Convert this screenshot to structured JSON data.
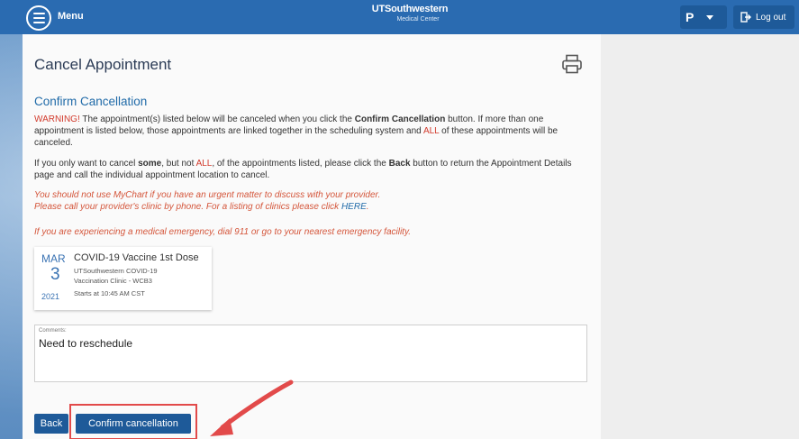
{
  "header": {
    "menu_label": "Menu",
    "logo_line1": "UTSouthwestern",
    "logo_line2": "Medical Center",
    "user_initial": "P",
    "logout_label": "Log out"
  },
  "page": {
    "title": "Cancel Appointment",
    "subtitle": "Confirm Cancellation",
    "warning_label": "WARNING!",
    "para1_a": " The appointment(s) listed below will be canceled when you click the ",
    "para1_bold": "Confirm Cancellation",
    "para1_b": " button.  If more than one appointment is listed below, those appointments are linked together in the scheduling system and ",
    "para1_all": "ALL",
    "para1_c": " of these appointments will be canceled.",
    "para2_a": "If you only want to cancel ",
    "para2_some": "some",
    "para2_b": ", but not ",
    "para2_all": "ALL",
    "para2_c": ", of the appointments listed, please click the ",
    "para2_back": "Back",
    "para2_d": " button to return the Appointment Details page and call the individual appointment location to cancel.",
    "notice_line1": "You should not use MyChart if you have an urgent matter to discuss with your provider.",
    "notice_line2_a": "Please call your provider's clinic by phone. For a listing of clinics please click ",
    "notice_link": "HERE",
    "notice_line2_end": ".",
    "emergency": "If you are experiencing a medical emergency, dial 911 or go to your nearest emergency facility."
  },
  "appointment": {
    "month": "MAR",
    "day": "3",
    "year": "2021",
    "title": "COVID-19 Vaccine 1st Dose",
    "location_line1": "UTSouthwestern COVID-19",
    "location_line2": "Vaccination Clinic - WCB3",
    "start": "Starts at 10:45 AM CST"
  },
  "comments": {
    "label": "Comments:",
    "value": "Need to reschedule"
  },
  "buttons": {
    "back": "Back",
    "confirm": "Confirm cancellation"
  },
  "colors": {
    "header_bg": "#2a6bb1",
    "button_bg": "#1e5a99",
    "warning": "#d23a2c",
    "highlight": "#e24a4a"
  }
}
